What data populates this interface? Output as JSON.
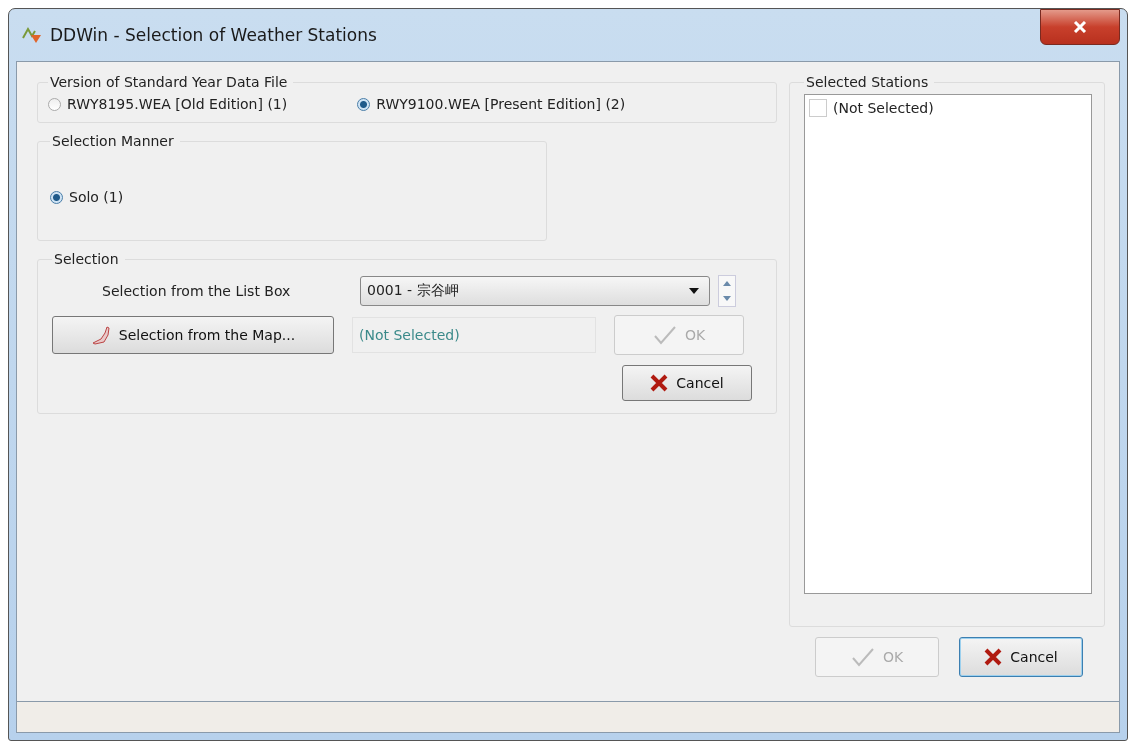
{
  "window": {
    "title": "DDWin - Selection of Weather Stations"
  },
  "version_group": {
    "label": "Version of Standard Year Data File",
    "options": [
      {
        "label": "RWY8195.WEA [Old Edition] (1)",
        "selected": false
      },
      {
        "label": "RWY9100.WEA [Present Edition] (2)",
        "selected": true
      }
    ]
  },
  "manner_group": {
    "label": "Selection Manner",
    "options": [
      {
        "label": "Solo (1)",
        "selected": true
      }
    ]
  },
  "selection_group": {
    "label": "Selection",
    "list_label": "Selection from the List Box",
    "list_value": "0001 - 宗谷岬",
    "map_button": "Selection from the Map...",
    "map_result": "(Not Selected)",
    "ok": {
      "label": "OK",
      "disabled": true
    },
    "cancel": {
      "label": "Cancel",
      "disabled": false
    }
  },
  "stations_group": {
    "label": "Selected Stations",
    "items": [
      {
        "label": "(Not Selected)",
        "checked": false
      }
    ]
  },
  "ok": {
    "label": "OK",
    "disabled": true
  },
  "cancel": {
    "label": "Cancel",
    "disabled": false
  }
}
